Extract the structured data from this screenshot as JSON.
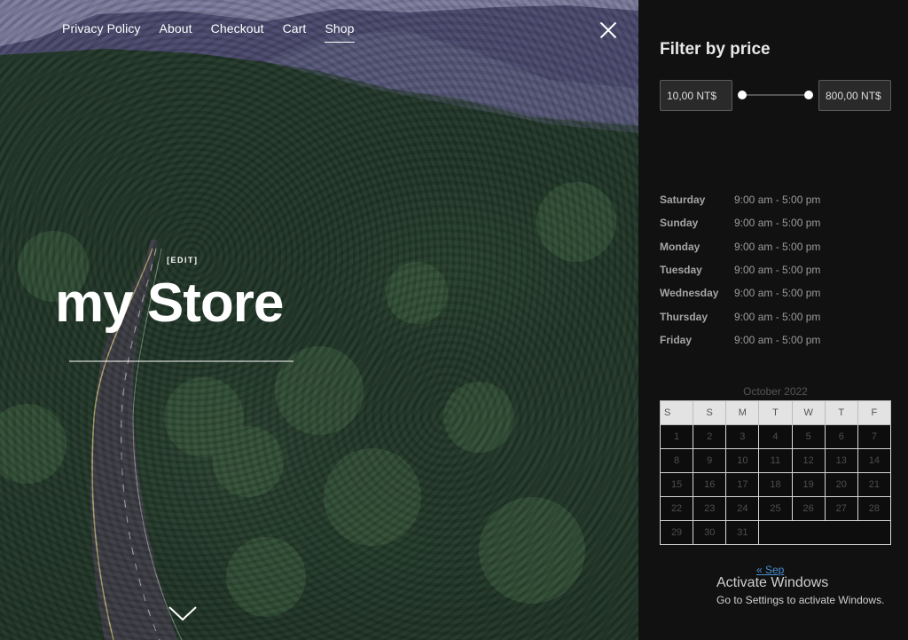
{
  "nav": {
    "items": [
      {
        "label": "Privacy Policy",
        "active": false
      },
      {
        "label": "About",
        "active": false
      },
      {
        "label": "Checkout",
        "active": false
      },
      {
        "label": "Cart",
        "active": false
      },
      {
        "label": "Shop",
        "active": true
      }
    ]
  },
  "hero": {
    "edit_label": "[EDIT]",
    "site_title": "my Store"
  },
  "icons": {
    "close": "close-icon",
    "scroll_down": "chevron-down-icon"
  },
  "filter": {
    "title": "Filter by price",
    "min_value": "10,00 NT$",
    "max_value": "800,00 NT$"
  },
  "hours": [
    {
      "day": "Saturday",
      "time": "9:00 am - 5:00 pm"
    },
    {
      "day": "Sunday",
      "time": "9:00 am - 5:00 pm"
    },
    {
      "day": "Monday",
      "time": "9:00 am - 5:00 pm"
    },
    {
      "day": "Tuesday",
      "time": "9:00 am - 5:00 pm"
    },
    {
      "day": "Wednesday",
      "time": "9:00 am - 5:00 pm"
    },
    {
      "day": "Thursday",
      "time": "9:00 am - 5:00 pm"
    },
    {
      "day": "Friday",
      "time": "9:00 am - 5:00 pm"
    }
  ],
  "calendar": {
    "caption": "October 2022",
    "weekdays": [
      "S",
      "S",
      "M",
      "T",
      "W",
      "T",
      "F"
    ],
    "weeks": [
      [
        "1",
        "2",
        "3",
        "4",
        "5",
        "6",
        "7"
      ],
      [
        "8",
        "9",
        "10",
        "11",
        "12",
        "13",
        "14"
      ],
      [
        "15",
        "16",
        "17",
        "18",
        "19",
        "20",
        "21"
      ],
      [
        "22",
        "23",
        "24",
        "25",
        "26",
        "27",
        "28"
      ],
      [
        "29",
        "30",
        "31",
        "",
        "",
        "",
        ""
      ]
    ],
    "prev_link": "« Sep"
  },
  "watermark": {
    "title": "Activate Windows",
    "subtitle": "Go to Settings to activate Windows."
  },
  "colors": {
    "sidebar_bg": "#111111",
    "link": "#4a8fd0"
  }
}
